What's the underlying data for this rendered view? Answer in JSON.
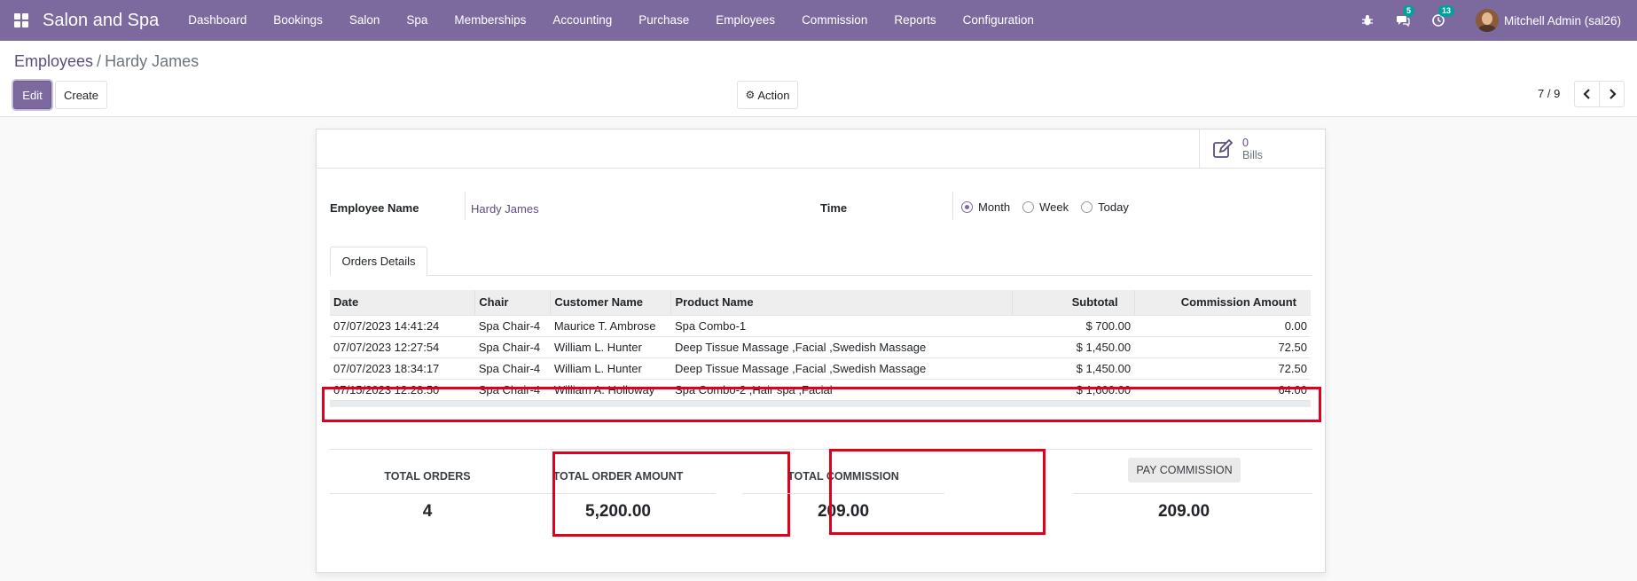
{
  "navbar": {
    "app_name": "Salon and Spa",
    "menu": [
      "Dashboard",
      "Bookings",
      "Salon",
      "Spa",
      "Memberships",
      "Accounting",
      "Purchase",
      "Employees",
      "Commission",
      "Reports",
      "Configuration"
    ],
    "messages_count": "5",
    "activities_count": "13",
    "user": "Mitchell Admin (sal26)"
  },
  "breadcrumb": {
    "parent": "Employees",
    "separator": "/",
    "current": "Hardy James"
  },
  "toolbar": {
    "edit": "Edit",
    "create": "Create",
    "action": "Action"
  },
  "pager": {
    "value": "7 / 9"
  },
  "stat_button": {
    "count": "0",
    "label": "Bills"
  },
  "form": {
    "employee_label": "Employee Name",
    "employee_value": "Hardy James",
    "time_label": "Time",
    "time_options": [
      "Month",
      "Week",
      "Today"
    ],
    "time_selected": "Month"
  },
  "tab": {
    "label": "Orders Details"
  },
  "orders": {
    "headers": [
      "Date",
      "Chair",
      "Customer Name",
      "Product Name",
      "Subtotal",
      "Commission Amount"
    ],
    "rows": [
      [
        "07/07/2023 14:41:24",
        "Spa Chair-4",
        "Maurice T. Ambrose",
        "Spa Combo-1",
        "$ 700.00",
        "0.00"
      ],
      [
        "07/07/2023 12:27:54",
        "Spa Chair-4",
        "William L. Hunter",
        "Deep Tissue Massage ,Facial ,Swedish Massage",
        "$ 1,450.00",
        "72.50"
      ],
      [
        "07/07/2023 18:34:17",
        "Spa Chair-4",
        "William L. Hunter",
        "Deep Tissue Massage ,Facial ,Swedish Massage",
        "$ 1,450.00",
        "72.50"
      ],
      [
        "07/15/2023 12:28:50",
        "Spa Chair-4",
        "William A. Holloway",
        "Spa Combo-2 ,Hair spa ,Facial",
        "$ 1,600.00",
        "64.00"
      ]
    ]
  },
  "totals": {
    "orders_label": "TOTAL ORDERS",
    "orders_value": "4",
    "amount_label": "TOTAL ORDER AMOUNT",
    "amount_value": "5,200.00",
    "commission_label": "TOTAL COMMISSION",
    "commission_value": "209.00",
    "pay_label": "PAY COMMISSION",
    "pay_value": "209.00"
  },
  "colors": {
    "brand": "#7c6a9f",
    "highlight": "#e0001b",
    "badge": "#00a09d"
  }
}
